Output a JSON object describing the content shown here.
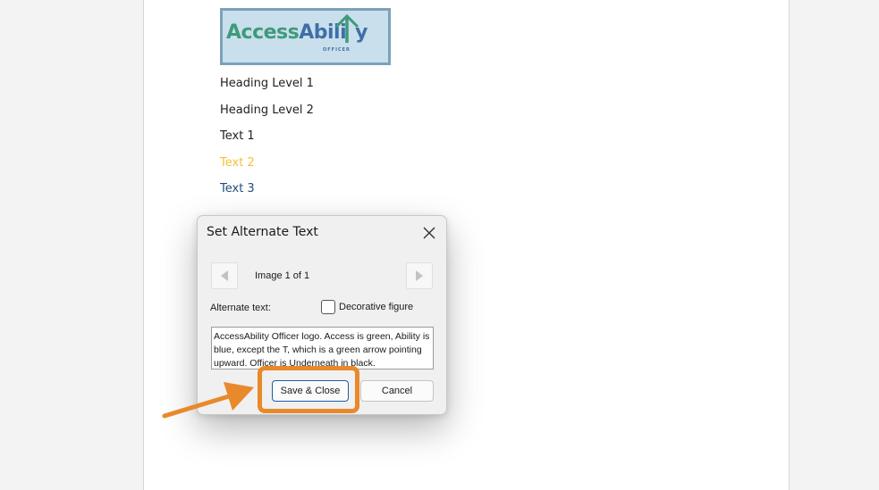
{
  "document": {
    "logo": {
      "word_access": "Access",
      "word_abili": "Abili",
      "word_t": "t",
      "word_y": "y",
      "tagline": "OFFICER"
    },
    "lines": [
      {
        "text": "Heading Level 1",
        "color": "#1f1f1f"
      },
      {
        "text": "Heading Level 2",
        "color": "#1f1f1f"
      },
      {
        "text": "Text 1",
        "color": "#1f1f1f"
      },
      {
        "text": "Text 2",
        "color": "#f6c13a"
      },
      {
        "text": "Text 3",
        "color": "#1f4e79"
      }
    ]
  },
  "dialog": {
    "title": "Set Alternate Text",
    "close_icon": "close-icon",
    "prev_icon": "triangle-left-icon",
    "next_icon": "triangle-right-icon",
    "image_counter": "Image 1 of 1",
    "alt_text_label": "Alternate text:",
    "decorative_label": "Decorative figure",
    "decorative_checked": false,
    "alt_text_value": "AccessAbility Officer logo. Access is green, Ability is blue, except the T, which is a green arrow pointing upward. Officer is Underneath in black.",
    "save_label": "Save & Close",
    "cancel_label": "Cancel"
  },
  "annotation": {
    "highlight_color": "#e8892b",
    "arrow_icon": "arrow-pointer-icon"
  }
}
